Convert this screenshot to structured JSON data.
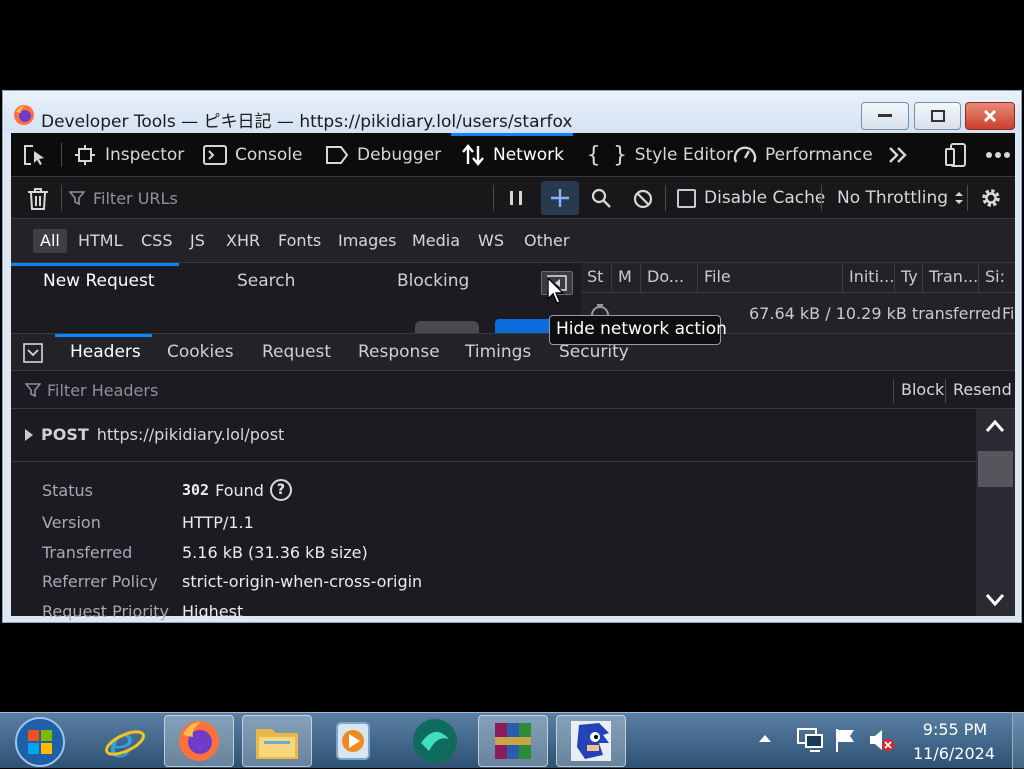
{
  "window": {
    "title": "Developer Tools — ピキ日記 — https://pikidiary.lol/users/starfox"
  },
  "toolbox": {
    "tabs": [
      {
        "label": "Inspector"
      },
      {
        "label": "Console"
      },
      {
        "label": "Debugger"
      },
      {
        "label": "Network"
      },
      {
        "label": "Style Editor"
      },
      {
        "label": "Performance"
      }
    ]
  },
  "network_toolbar": {
    "filter_placeholder": "Filter URLs",
    "disable_cache_label": "Disable Cache",
    "throttling_label": "No Throttling"
  },
  "type_filters": [
    "All",
    "HTML",
    "CSS",
    "JS",
    "XHR",
    "Fonts",
    "Images",
    "Media",
    "WS",
    "Other"
  ],
  "sub_panel_tabs": [
    "New Request",
    "Search",
    "Blocking"
  ],
  "request_list": {
    "columns": [
      "St",
      "M",
      "Do...",
      "File",
      "Initi...",
      "Ty",
      "Tran...",
      "Si:"
    ],
    "row_transferred": "67.64 kB / 10.29 kB transferred",
    "row_trailing": "Fi"
  },
  "tooltip": {
    "text": "Hide network action"
  },
  "detail_tabs": [
    "Headers",
    "Cookies",
    "Request",
    "Response",
    "Timings",
    "Security"
  ],
  "headers_panel": {
    "filter_placeholder": "Filter Headers",
    "block_label": "Block",
    "resend_label": "Resend",
    "request_method": "POST",
    "request_url": "https://pikidiary.lol/post",
    "rows": [
      {
        "name": "Status",
        "value": "Found",
        "code": "302"
      },
      {
        "name": "Version",
        "value": "HTTP/1.1"
      },
      {
        "name": "Transferred",
        "value": "5.16 kB (31.36 kB size)"
      },
      {
        "name": "Referrer Policy",
        "value": "strict-origin-when-cross-origin"
      },
      {
        "name": "Request Priority",
        "value": "Highest"
      }
    ]
  },
  "taskbar": {
    "time": "9:55 PM",
    "date": "11/6/2024"
  },
  "colors": {
    "accent": "#0a84ff",
    "devtools_bg": "#232327",
    "toolbox_bg": "#0c0c0d"
  }
}
